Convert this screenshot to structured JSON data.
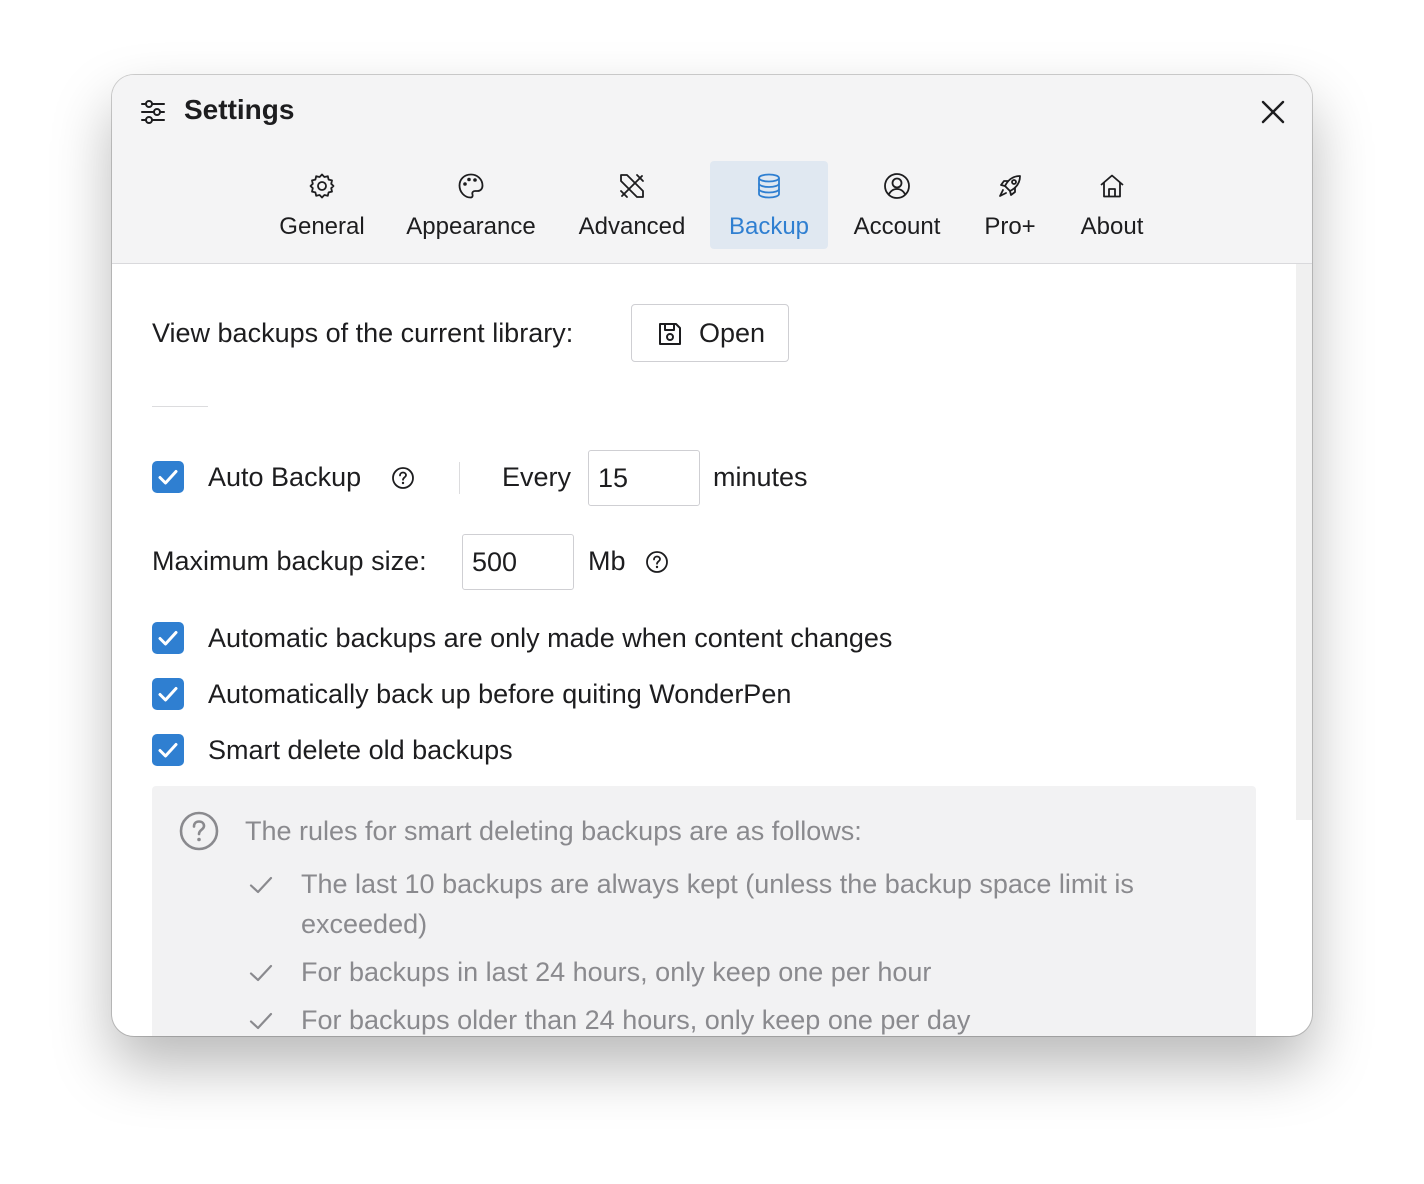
{
  "window": {
    "title": "Settings"
  },
  "tabs": [
    {
      "label": "General",
      "icon": "gear-icon"
    },
    {
      "label": "Appearance",
      "icon": "palette-icon"
    },
    {
      "label": "Advanced",
      "icon": "tools-icon"
    },
    {
      "label": "Backup",
      "icon": "database-icon",
      "active": true
    },
    {
      "label": "Account",
      "icon": "user-circle-icon"
    },
    {
      "label": "Pro+",
      "icon": "rocket-icon"
    },
    {
      "label": "About",
      "icon": "home-icon"
    }
  ],
  "backup": {
    "view_label": "View backups of the current library:",
    "open_label": "Open",
    "auto_backup_label": "Auto Backup",
    "auto_backup_checked": true,
    "every_label": "Every",
    "interval_value": "15",
    "minutes_label": "minutes",
    "max_size_label": "Maximum backup size:",
    "max_size_value": "500",
    "size_unit": "Mb",
    "options": [
      {
        "label": "Automatic backups are only made when content changes",
        "checked": true
      },
      {
        "label": "Automatically back up before quiting WonderPen",
        "checked": true
      },
      {
        "label": "Smart delete old backups",
        "checked": true
      }
    ],
    "rules_title": "The rules for smart deleting backups are as follows:",
    "rules": [
      "The last 10 backups are always kept (unless the backup space limit is exceeded)",
      "For backups in last 24 hours, only keep one per hour",
      "For backups older than 24 hours, only keep one per day"
    ]
  },
  "colors": {
    "accent": "#2f7fd1",
    "active_tab_bg": "#e0e8f1",
    "header_bg": "#f4f4f5",
    "muted_text": "#8a8a8e"
  }
}
